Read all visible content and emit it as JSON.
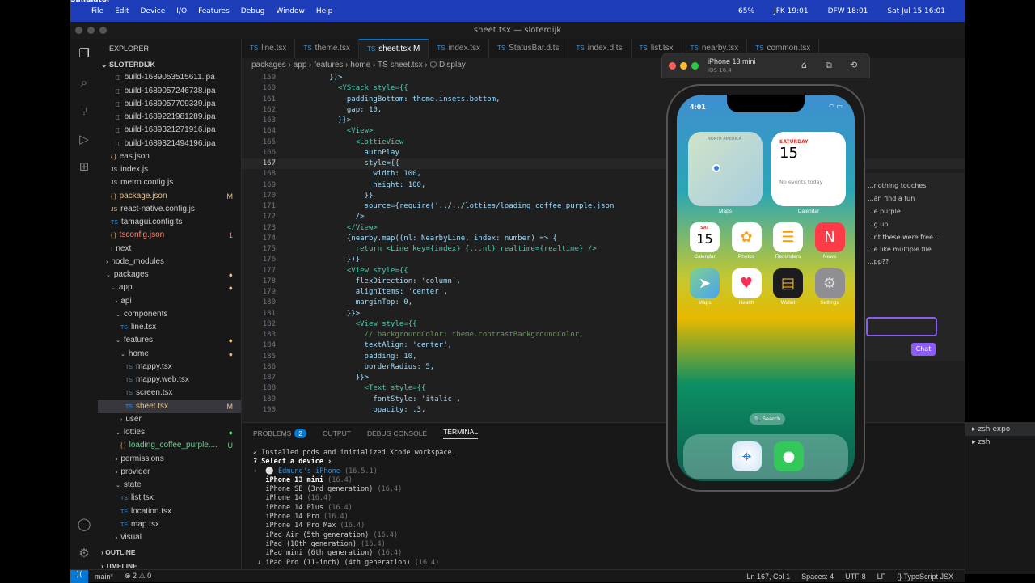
{
  "menubar": {
    "app": "Simulator",
    "items": [
      "File",
      "Edit",
      "Device",
      "I/O",
      "Features",
      "Debug",
      "Window",
      "Help"
    ],
    "battery": "65%",
    "clock1": "JFK 19:01",
    "clock2": "DFW 18:01",
    "datetime": "Sat Jul 15  16:01"
  },
  "window": {
    "title": "sheet.tsx — sloterdijk"
  },
  "explorer": {
    "header": "EXPLORER",
    "project": "SLOTERDIJK",
    "rows": [
      {
        "t": "build-1689053515611.ipa",
        "d": 2,
        "k": "file"
      },
      {
        "t": "build-1689057246738.ipa",
        "d": 2,
        "k": "file"
      },
      {
        "t": "build-1689057709339.ipa",
        "d": 2,
        "k": "file"
      },
      {
        "t": "build-1689221981289.ipa",
        "d": 2,
        "k": "file"
      },
      {
        "t": "build-1689321271916.ipa",
        "d": 2,
        "k": "file"
      },
      {
        "t": "build-1689321494196.ipa",
        "d": 2,
        "k": "file"
      },
      {
        "t": "eas.json",
        "d": 1,
        "k": "json"
      },
      {
        "t": "index.js",
        "d": 1,
        "k": "js"
      },
      {
        "t": "metro.config.js",
        "d": 1,
        "k": "js"
      },
      {
        "t": "package.json",
        "d": 1,
        "k": "json",
        "s": "M",
        "c": "#e2c08d"
      },
      {
        "t": "react-native.config.js",
        "d": 1,
        "k": "js"
      },
      {
        "t": "tamagui.config.ts",
        "d": 1,
        "k": "ts"
      },
      {
        "t": "tsconfig.json",
        "d": 1,
        "k": "json",
        "s": "1",
        "c": "#f48771"
      },
      {
        "t": "next",
        "d": 1,
        "k": "dirc"
      },
      {
        "t": "node_modules",
        "d": 0,
        "k": "dirc"
      },
      {
        "t": "packages",
        "d": 0,
        "k": "diro",
        "s": "●",
        "c": "#e2c08d"
      },
      {
        "t": "app",
        "d": 1,
        "k": "diro",
        "s": "●",
        "c": "#e2c08d"
      },
      {
        "t": "api",
        "d": 2,
        "k": "dirc"
      },
      {
        "t": "components",
        "d": 2,
        "k": "diro"
      },
      {
        "t": "line.tsx",
        "d": 3,
        "k": "ts"
      },
      {
        "t": "features",
        "d": 2,
        "k": "diro",
        "s": "●",
        "c": "#e2c08d"
      },
      {
        "t": "home",
        "d": 3,
        "k": "diro",
        "s": "●",
        "c": "#e2c08d"
      },
      {
        "t": "mappy.tsx",
        "d": 4,
        "k": "ts"
      },
      {
        "t": "mappy.web.tsx",
        "d": 4,
        "k": "ts"
      },
      {
        "t": "screen.tsx",
        "d": 4,
        "k": "ts"
      },
      {
        "t": "sheet.tsx",
        "d": 4,
        "k": "ts",
        "s": "M",
        "c": "#e2c08d",
        "sel": true
      },
      {
        "t": "user",
        "d": 3,
        "k": "dirc"
      },
      {
        "t": "lotties",
        "d": 2,
        "k": "diro",
        "s": "●",
        "c": "#73c991"
      },
      {
        "t": "loading_coffee_purple....",
        "d": 3,
        "k": "json",
        "s": "U",
        "c": "#73c991"
      },
      {
        "t": "permissions",
        "d": 2,
        "k": "dirc"
      },
      {
        "t": "provider",
        "d": 2,
        "k": "dirc"
      },
      {
        "t": "state",
        "d": 2,
        "k": "diro"
      },
      {
        "t": "list.tsx",
        "d": 3,
        "k": "ts"
      },
      {
        "t": "location.tsx",
        "d": 3,
        "k": "ts"
      },
      {
        "t": "map.tsx",
        "d": 3,
        "k": "ts"
      },
      {
        "t": "visual",
        "d": 2,
        "k": "dirc"
      }
    ],
    "outline": "OUTLINE",
    "timeline": "TIMELINE"
  },
  "tabs": [
    {
      "label": "line.tsx"
    },
    {
      "label": "theme.tsx"
    },
    {
      "label": "sheet.tsx M",
      "on": true
    },
    {
      "label": "index.tsx"
    },
    {
      "label": "StatusBar.d.ts"
    },
    {
      "label": "index.d.ts"
    },
    {
      "label": "list.tsx"
    },
    {
      "label": "nearby.tsx"
    },
    {
      "label": "common.tsx"
    }
  ],
  "breadcrumb": "packages  ›  app  ›  features  ›  home  ›  TS sheet.tsx  ›  ⬡ Display",
  "code": [
    {
      "n": "159",
      "t": "          })>"
    },
    {
      "n": "160",
      "t": "            <YStack style={{"
    },
    {
      "n": "161",
      "t": "              paddingBottom: theme.insets.bottom,"
    },
    {
      "n": "162",
      "t": "              gap: 10,"
    },
    {
      "n": "163",
      "t": "            }}>"
    },
    {
      "n": "164",
      "t": "              <View>"
    },
    {
      "n": "165",
      "t": "                <LottieView"
    },
    {
      "n": "166",
      "t": "                  autoPlay"
    },
    {
      "n": "167",
      "t": "                  style={{",
      "cur": true
    },
    {
      "n": "168",
      "t": "                    width: 100,"
    },
    {
      "n": "169",
      "t": "                    height: 100,"
    },
    {
      "n": "170",
      "t": "                  }}"
    },
    {
      "n": "171",
      "t": "                  source={require('../../lotties/loading_coffee_purple.json"
    },
    {
      "n": "172",
      "t": "                />"
    },
    {
      "n": "173",
      "t": "              </View>"
    },
    {
      "n": "174",
      "t": "              {nearby.map((nl: NearbyLine, index: number) => {"
    },
    {
      "n": "175",
      "t": "                return <Line key={index} {...nl} realtime={realtime} />"
    },
    {
      "n": "176",
      "t": "              })}"
    },
    {
      "n": "177",
      "t": "              <View style={{"
    },
    {
      "n": "178",
      "t": "                flexDirection: 'column',"
    },
    {
      "n": "179",
      "t": "                alignItems: 'center',"
    },
    {
      "n": "180",
      "t": "                marginTop: 0,"
    },
    {
      "n": "181",
      "t": "              }}>"
    },
    {
      "n": "182",
      "t": "                <View style={{"
    },
    {
      "n": "183",
      "t": "                  // backgroundColor: theme.contrastBackgroundColor,"
    },
    {
      "n": "184",
      "t": "                  textAlign: 'center',"
    },
    {
      "n": "185",
      "t": "                  padding: 10,"
    },
    {
      "n": "186",
      "t": "                  borderRadius: 5,"
    },
    {
      "n": "187",
      "t": "                }}>"
    },
    {
      "n": "188",
      "t": "                  <Text style={{"
    },
    {
      "n": "189",
      "t": "                    fontStyle: 'italic',"
    },
    {
      "n": "190",
      "t": "                    opacity: .3,"
    }
  ],
  "panel": {
    "tabs": [
      "PROBLEMS",
      "OUTPUT",
      "DEBUG CONSOLE",
      "TERMINAL"
    ],
    "problems_count": "2",
    "terminal": [
      {
        "t": "✓ Installed pods and initialized Xcode workspace.",
        "c": "#ccc"
      },
      {
        "t": "? Select a device ›",
        "c": "#fff",
        "b": true
      },
      {
        "t": "›  ⚪ Edmund's iPhone",
        "d": " (16.5.1)",
        "c": "#3b8fd4"
      },
      {
        "t": "   iPhone 13 mini",
        "d": " (16.4)",
        "c": "#fff",
        "b": true
      },
      {
        "t": "   iPhone SE (3rd generation)",
        "d": " (16.4)",
        "c": "#ccc"
      },
      {
        "t": "   iPhone 14",
        "d": " (16.4)",
        "c": "#ccc"
      },
      {
        "t": "   iPhone 14 Plus",
        "d": " (16.4)",
        "c": "#ccc"
      },
      {
        "t": "   iPhone 14 Pro",
        "d": " (16.4)",
        "c": "#ccc"
      },
      {
        "t": "   iPhone 14 Pro Max",
        "d": " (16.4)",
        "c": "#ccc"
      },
      {
        "t": "   iPad Air (5th generation)",
        "d": " (16.4)",
        "c": "#ccc"
      },
      {
        "t": "   iPad (10th generation)",
        "d": " (16.4)",
        "c": "#ccc"
      },
      {
        "t": "   iPad mini (6th generation)",
        "d": " (16.4)",
        "c": "#ccc"
      },
      {
        "t": " ↓ iPad Pro (11-inch) (4th generation)",
        "d": " (16.4)",
        "c": "#ccc"
      }
    ],
    "sessions": [
      "zsh  expo",
      "zsh"
    ]
  },
  "status": {
    "branch": "main*",
    "problems": "⊗ 2 ⚠ 0",
    "pos": "Ln 167, Col 1",
    "spaces": "Spaces: 4",
    "enc": "UTF-8",
    "eol": "LF",
    "lang": "{} TypeScript JSX"
  },
  "simulator": {
    "device": "iPhone 13 mini",
    "os": "iOS 16.4",
    "time": "4:01",
    "widgets": {
      "maps": "Maps",
      "map_region": "NORTH AMERICA",
      "cal_day": "SATURDAY",
      "cal_date": "15",
      "cal_note": "No events today",
      "cal_label": "Calendar"
    },
    "apps": [
      "Calendar",
      "Photos",
      "Reminders",
      "News",
      "Maps",
      "Health",
      "Wallet",
      "Settings"
    ],
    "cal_icon_day": "SAT",
    "cal_icon_date": "15",
    "search": "🔍 Search"
  },
  "ghost": {
    "lines": [
      "...nothing touches",
      "...an find a fun",
      "...e purple",
      "...g up",
      "...nt these were free...",
      "...e like multiple file",
      "...pp??"
    ],
    "chat_btn": "Chat"
  }
}
